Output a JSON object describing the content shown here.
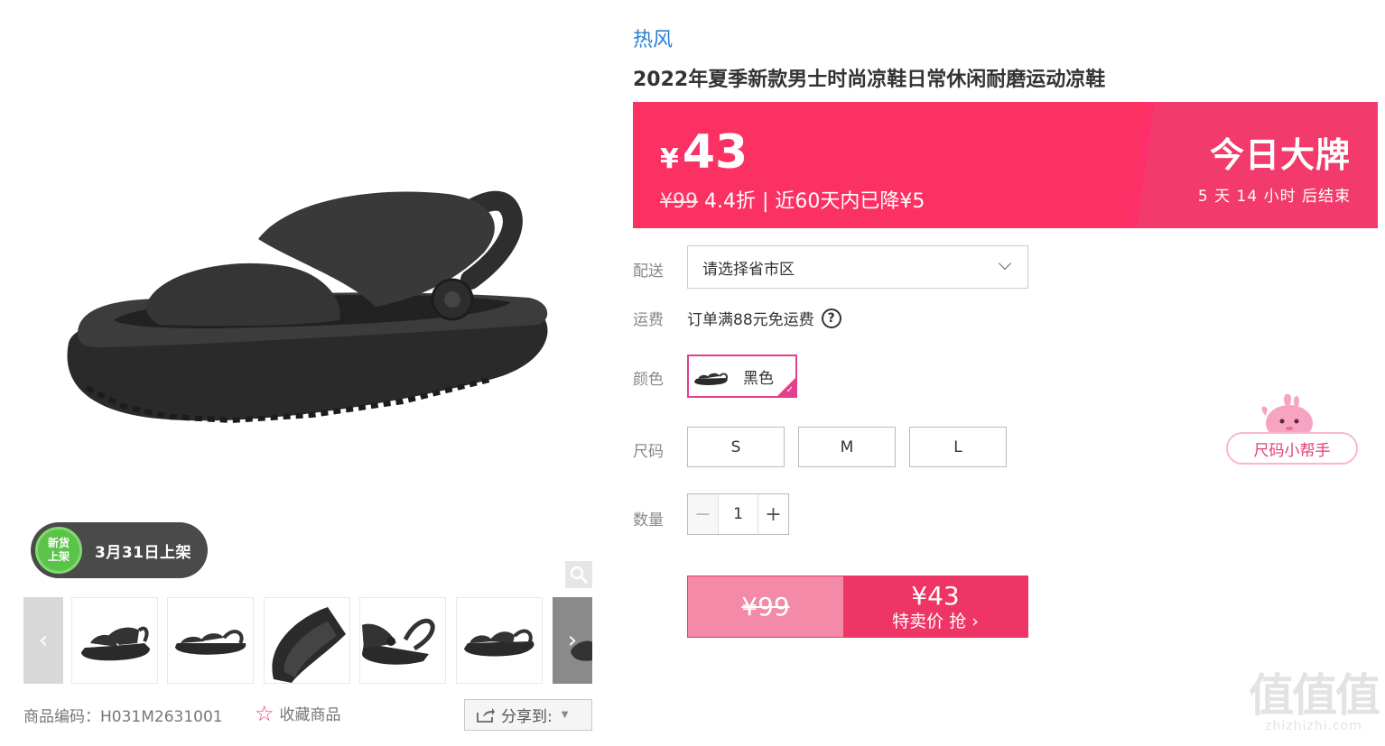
{
  "gallery": {
    "badge_line1": "新货",
    "badge_line2": "上架",
    "badge_text": "3月31日上架",
    "sku_label": "商品编码：H031M2631001",
    "favorite_label": "收藏商品",
    "share_label": "分享到:"
  },
  "product": {
    "brand": "热风",
    "title": "2022年夏季新款男士时尚凉鞋日常休闲耐磨运动凉鞋"
  },
  "price": {
    "currency": "¥",
    "current": "43",
    "original": "¥99",
    "discount_text": " 4.4折 | 近60天内已降¥5",
    "deal_title": "今日大牌",
    "timer": "5  天 14 小时 后结束",
    "colors": {
      "bar": "#fb3063",
      "accent": "#e53e8e"
    }
  },
  "options": {
    "delivery_label": "配送",
    "delivery_placeholder": "请选择省市区",
    "shipping_label": "运费",
    "shipping_text": "订单满88元免运费",
    "shipping_help": "?",
    "color_label": "颜色",
    "color_value": "黑色",
    "size_label": "尺码",
    "sizes": [
      "S",
      "M",
      "L"
    ],
    "qty_label": "数量",
    "qty_value": "1",
    "qty_minus": "−",
    "qty_plus": "+"
  },
  "buy": {
    "original": "¥99",
    "price": "¥43",
    "action": "特卖价 抢 ›"
  },
  "helper": {
    "label": "尺码小帮手"
  },
  "watermark": {
    "big": "值值值",
    "small": "zhizhizhi.com"
  }
}
